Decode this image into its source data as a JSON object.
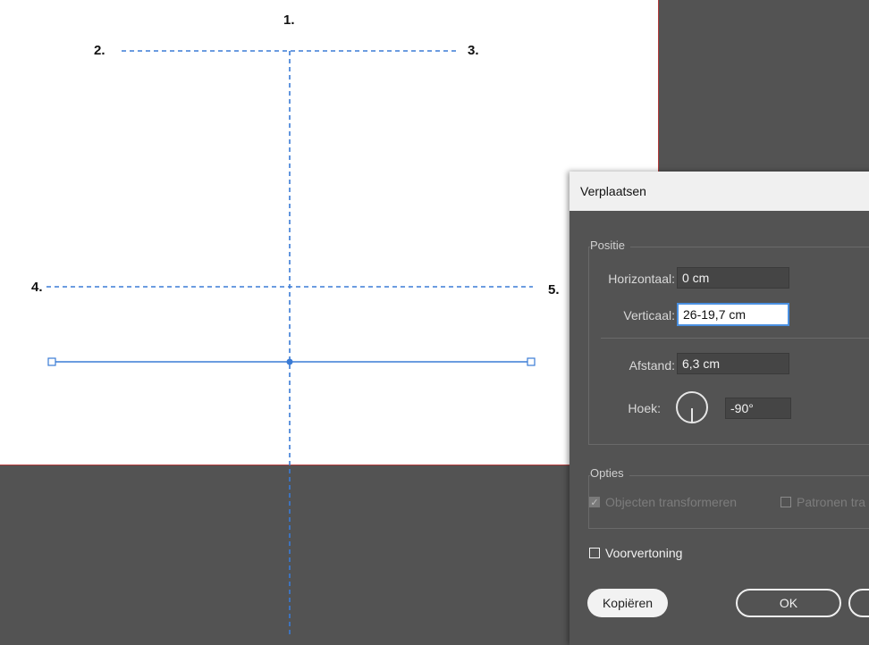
{
  "canvas": {
    "labels": [
      "1.",
      "2.",
      "3.",
      "4.",
      "5."
    ]
  },
  "dialog": {
    "title": "Verplaatsen",
    "position_group": {
      "title": "Positie",
      "horizontal_label": "Horizontaal:",
      "horizontal_value": "0 cm",
      "vertical_label": "Verticaal:",
      "vertical_value": "26-19,7 cm",
      "distance_label": "Afstand:",
      "distance_value": "6,3 cm",
      "angle_label": "Hoek:",
      "angle_value": "-90°"
    },
    "options_group": {
      "title": "Opties",
      "transform_objects": "Objecten transformeren",
      "transform_patterns": "Patronen tra"
    },
    "preview_label": "Voorvertoning",
    "buttons": {
      "copy": "Kopiëren",
      "ok": "OK"
    }
  },
  "colors": {
    "guide": "#3a7bd5",
    "artboard_border": "#b23b3b",
    "panel_bg": "#535353"
  }
}
